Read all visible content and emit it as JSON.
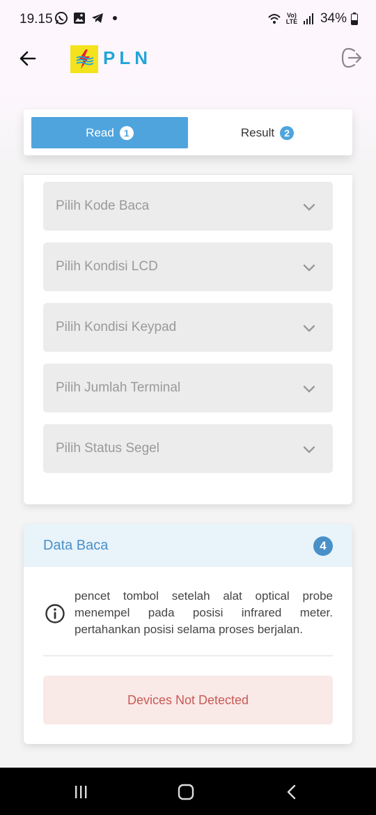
{
  "status_bar": {
    "time": "19.15",
    "left_icons": [
      "whatsapp-icon",
      "gallery-icon",
      "telegram-icon"
    ],
    "volte_label": "Vo) LTE",
    "battery": "34%"
  },
  "header": {
    "logo_text": "PLN",
    "back_icon": "arrow-left-icon",
    "logout_icon": "logout-icon"
  },
  "tabs": [
    {
      "label": "Read",
      "number": "1",
      "active": true
    },
    {
      "label": "Result",
      "number": "2",
      "active": false
    }
  ],
  "form": {
    "selects": [
      {
        "placeholder": "Pilih Kode Baca"
      },
      {
        "placeholder": "Pilih Kondisi LCD"
      },
      {
        "placeholder": "Pilih Kondisi Keypad"
      },
      {
        "placeholder": "Pilih Jumlah Terminal"
      },
      {
        "placeholder": "Pilih Status Segel"
      }
    ]
  },
  "data_baca": {
    "title": "Data Baca",
    "badge": "4",
    "info_text": "pencet tombol setelah alat optical probe menempel pada posisi infrared meter. pertahankan posisi selama proses berjalan.",
    "status": "Devices Not Detected"
  },
  "colors": {
    "accent": "#4fa4de",
    "brand_blue": "#22a5d8",
    "brand_yellow": "#f4e21c",
    "error_bg": "#f9e9e7",
    "error_text": "#c85a55"
  }
}
